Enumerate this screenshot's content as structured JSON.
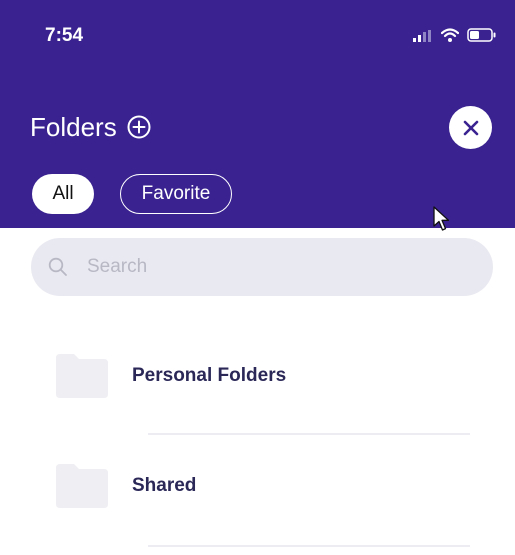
{
  "status_bar": {
    "time": "7:54",
    "icons": [
      "signal-icon",
      "wifi-icon",
      "battery-icon"
    ]
  },
  "header": {
    "title": "Folders",
    "add_icon": "plus-circle-icon",
    "close_icon": "close-icon",
    "background_color": "#3a2391"
  },
  "filters": {
    "tabs": [
      {
        "label": "All",
        "active": true
      },
      {
        "label": "Favorite",
        "active": false
      }
    ]
  },
  "search": {
    "placeholder": "Search",
    "value": "",
    "icon": "search-icon"
  },
  "folders": [
    {
      "label": "Personal Folders",
      "icon": "folder-icon"
    },
    {
      "label": "Shared",
      "icon": "folder-icon"
    }
  ],
  "colors": {
    "accent": "#3a2391",
    "folder_text": "#2b2858",
    "search_bg": "#e9e9f1",
    "folder_icon": "#eeeef3"
  }
}
